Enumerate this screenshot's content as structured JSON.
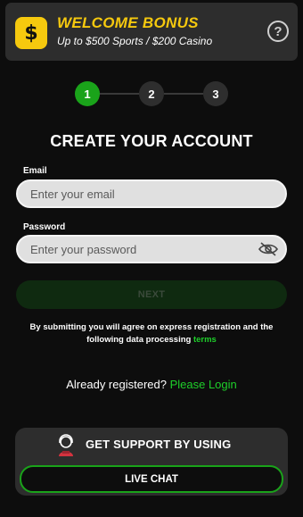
{
  "banner": {
    "icon": "dollar-icon",
    "icon_glyph": "$",
    "title": "WELCOME BONUS",
    "subtitle": "Up to $500 Sports / $200 Casino",
    "help_glyph": "?"
  },
  "steps": [
    {
      "label": "1",
      "state": "active"
    },
    {
      "label": "2",
      "state": "inactive"
    },
    {
      "label": "3",
      "state": "inactive"
    }
  ],
  "form": {
    "title": "CREATE YOUR ACCOUNT",
    "email_label": "Email",
    "email_placeholder": "Enter your email",
    "email_value": "",
    "password_label": "Password",
    "password_placeholder": "Enter your password",
    "password_value": "",
    "next_label": "NEXT"
  },
  "terms": {
    "text": "By submitting you will agree on express registration and the following data processing",
    "link_label": "terms"
  },
  "login": {
    "prompt": "Already registered?",
    "link_label": "Please Login"
  },
  "support": {
    "title": "GET SUPPORT BY USING",
    "chat_label": "LIVE CHAT"
  },
  "colors": {
    "accent_green": "#1aa31a",
    "link_green": "#1ecf2a",
    "bonus_yellow": "#f6c90e",
    "panel": "#2d2d2d",
    "background": "#0d0d0d"
  }
}
